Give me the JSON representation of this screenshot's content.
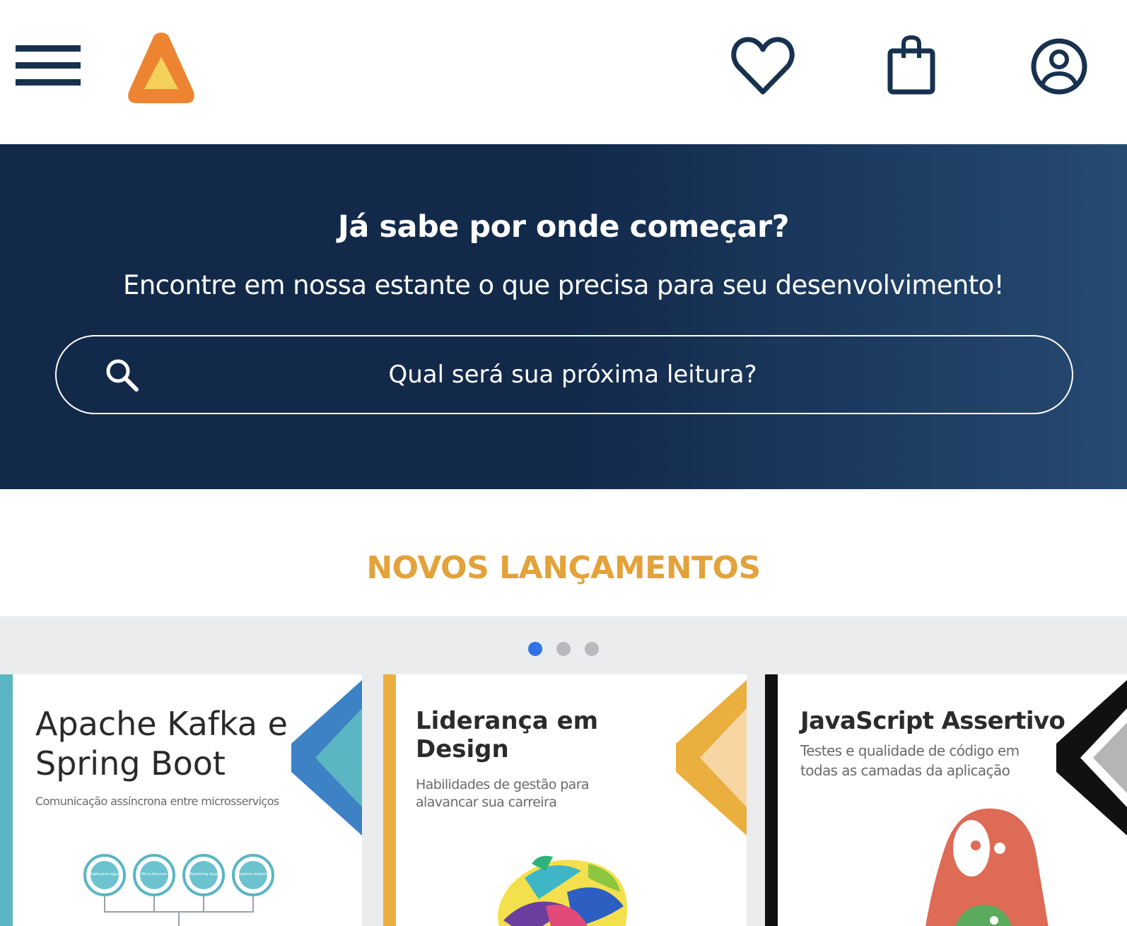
{
  "header": {
    "menu_icon": "hamburger-menu-icon",
    "logo_icon": "triangle-logo-icon",
    "favorites_icon": "heart-icon",
    "bag_icon": "shopping-bag-icon",
    "account_icon": "user-circle-icon",
    "icon_color": "#17314f",
    "logo_colors": {
      "outer": "#ed8432",
      "inner": "#f5d05a"
    }
  },
  "hero": {
    "title": "Já sabe por onde começar?",
    "subtitle": "Encontre em nossa estante o que precisa para seu desenvolvimento!",
    "search": {
      "icon": "search-icon",
      "placeholder": "Qual será sua próxima leitura?",
      "value": ""
    },
    "colors": {
      "from": "#12294a",
      "to": "#264a72"
    }
  },
  "releases": {
    "title": "NOVOS LANÇAMENTOS",
    "title_color": "#e3a23a",
    "carousel": {
      "active_dot": 1,
      "dot_count": 3,
      "dot_active_color": "#2f73e6",
      "books": [
        {
          "title": "Apache Kafka e Spring Boot",
          "subtitle": "Comunicação assíncrona entre microsserviços",
          "accent": "#5bb5c3",
          "art_labels": [
            "Application Apps",
            "Micro Services",
            "Monitoring Apps",
            "Realtime Analytics"
          ]
        },
        {
          "title": "Liderança em Design",
          "subtitle": "Habilidades de gestão para alavancar sua carreira",
          "accent": "#eaaf3e"
        },
        {
          "title": "JavaScript Assertivo",
          "subtitle": "Testes e qualidade de código em todas as camadas da aplicação",
          "accent": "#111111"
        }
      ]
    }
  }
}
